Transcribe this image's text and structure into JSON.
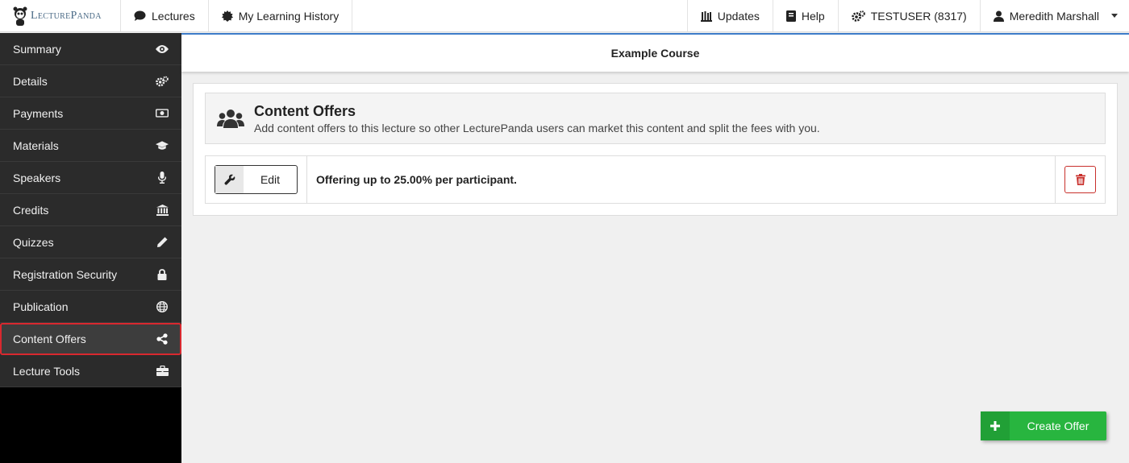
{
  "brand": {
    "name": "LecturePanda"
  },
  "topnav": {
    "lectures": "Lectures",
    "history": "My Learning History",
    "updates": "Updates",
    "help": "Help",
    "account": "TESTUSER (8317)",
    "user": "Meredith Marshall"
  },
  "sidebar": {
    "items": [
      {
        "label": "Summary",
        "icon": "eye-icon"
      },
      {
        "label": "Details",
        "icon": "gears-icon"
      },
      {
        "label": "Payments",
        "icon": "money-icon"
      },
      {
        "label": "Materials",
        "icon": "graduation-cap-icon"
      },
      {
        "label": "Speakers",
        "icon": "microphone-icon"
      },
      {
        "label": "Credits",
        "icon": "institution-icon"
      },
      {
        "label": "Quizzes",
        "icon": "pencil-icon"
      },
      {
        "label": "Registration Security",
        "icon": "lock-icon"
      },
      {
        "label": "Publication",
        "icon": "globe-icon"
      },
      {
        "label": "Content Offers",
        "icon": "share-icon",
        "active": true
      },
      {
        "label": "Lecture Tools",
        "icon": "briefcase-icon"
      }
    ]
  },
  "main": {
    "course_title": "Example Course",
    "section_title": "Content Offers",
    "section_subtitle": "Add content offers to this lecture so other LecturePanda users can market this content and split the fees with you.",
    "offer": {
      "edit_label": "Edit",
      "text": "Offering up to 25.00% per participant."
    },
    "create_label": "Create Offer"
  },
  "colors": {
    "active_border": "#d9282f",
    "create_green": "#28b53f",
    "delete_red": "#c9302c",
    "accent_blue": "#3d7cc9"
  }
}
